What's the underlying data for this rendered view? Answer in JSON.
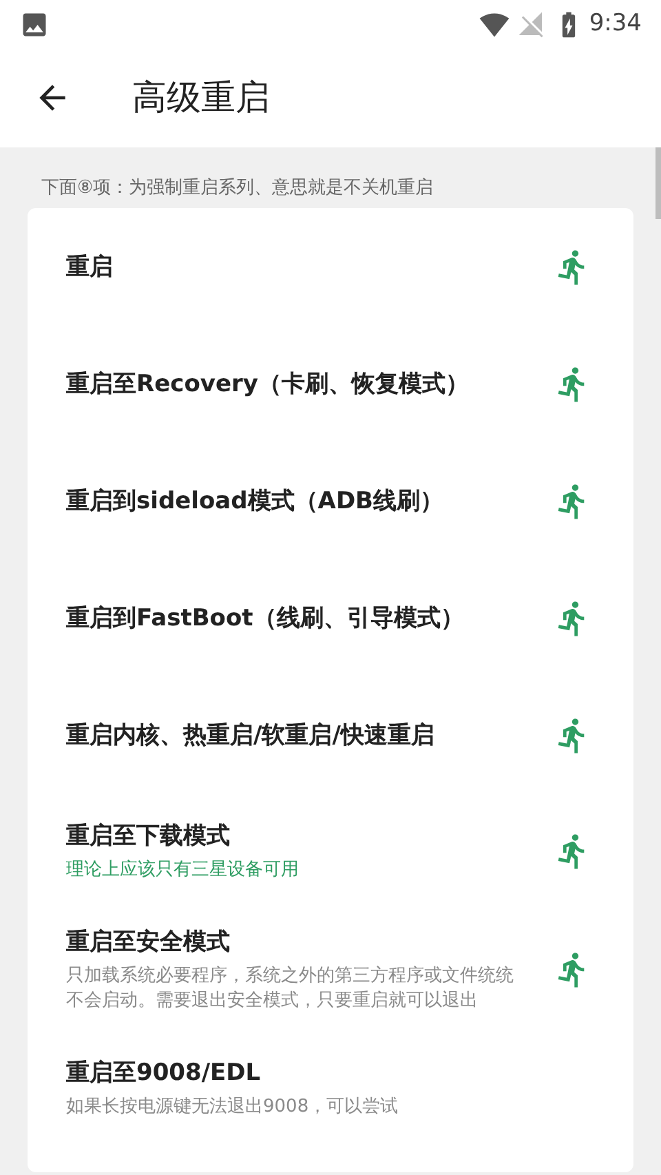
{
  "status_bar": {
    "time": "9:34"
  },
  "app_bar": {
    "title": "高级重启"
  },
  "caption": "下面⑧项：为强制重启系列、意思就是不关机重启",
  "items": [
    {
      "title": "重启"
    },
    {
      "title": "重启至Recovery（卡刷、恢复模式）"
    },
    {
      "title": "重启到sideload模式（ADB线刷）"
    },
    {
      "title": "重启到FastBoot（线刷、引导模式）"
    },
    {
      "title": "重启内核、热重启/软重启/快速重启"
    },
    {
      "title": "重启至下载模式",
      "description": {
        "text": "理论上应该只有三星设备可用",
        "kind": "hint"
      }
    },
    {
      "title": "重启至安全模式",
      "description": {
        "text": "只加载系统必要程序，系统之外的第三方程序或文件统统不会启动。需要退出安全模式，只要重启就可以退出",
        "kind": "detail"
      }
    },
    {
      "title": "重启至9008/EDL",
      "description": {
        "text": "如果长按电源键无法退出9008，可以尝试",
        "kind": "detail"
      },
      "action_hidden": true
    }
  ]
}
